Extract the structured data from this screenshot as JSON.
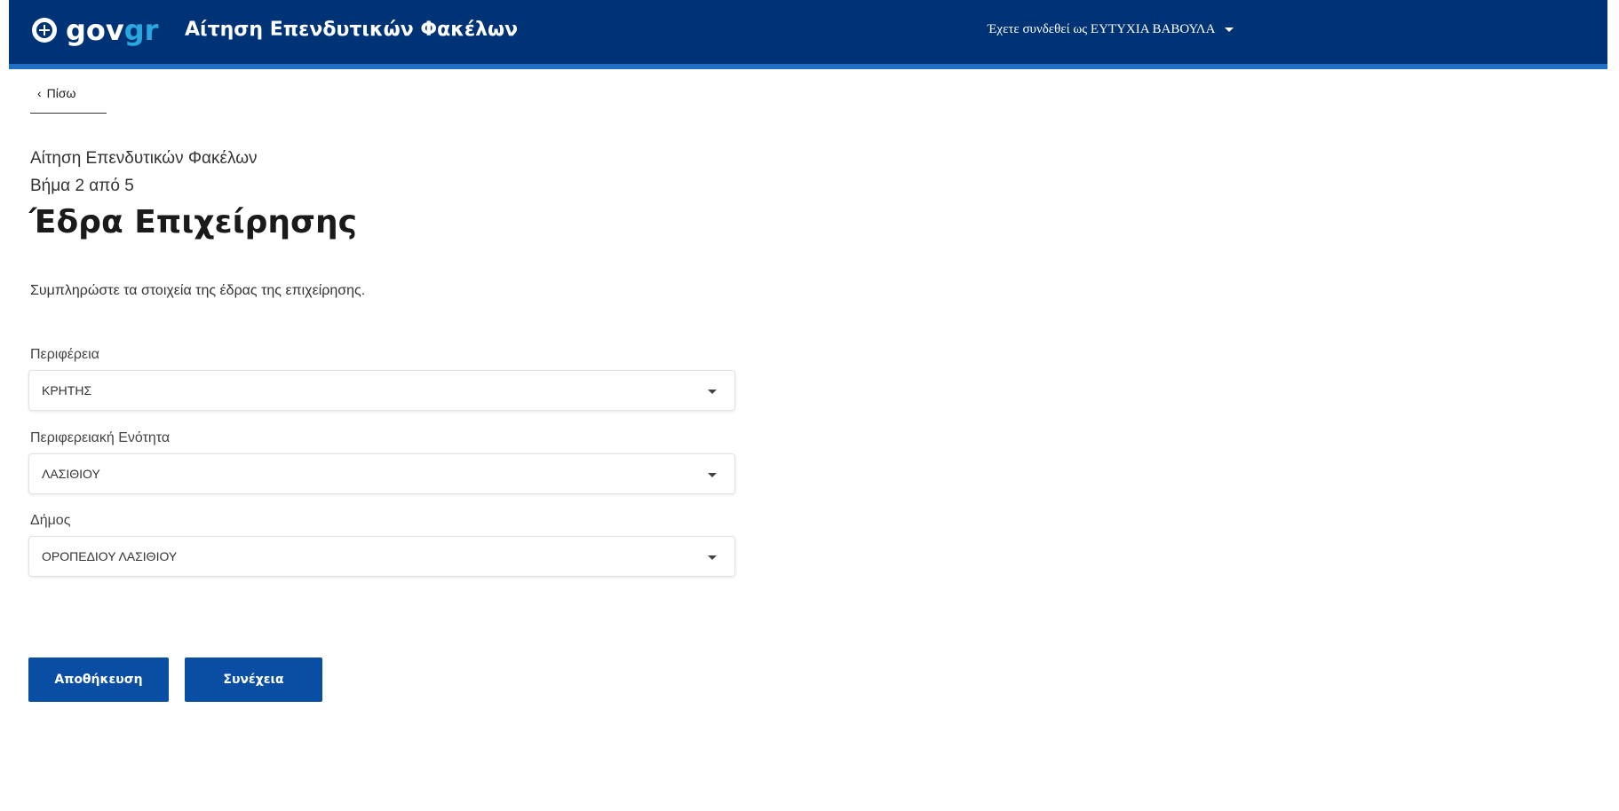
{
  "header": {
    "logo_text_gov": "gov",
    "logo_text_gr": "gr",
    "app_title": "Αίτηση Επενδυτικών Φακέλων",
    "user_text": "Έχετε συνδεθεί ως ΕΥΤΥΧΙΑ ΒΑΒΟΥΛΑ",
    "colors": {
      "background": "#003376",
      "accent_stripe": "#1f6fc2",
      "logo_gr": "#29a8e0"
    }
  },
  "back": {
    "label": "Πίσω"
  },
  "form_header": {
    "caption": "Αίτηση Επενδυτικών Φακέλων",
    "step": "Βήμα 2 από 5",
    "title": "Έδρα Επιχείρησης",
    "hint": "Συμπληρώστε τα στοιχεία της έδρας της επιχείρησης."
  },
  "fields": [
    {
      "label": "Περιφέρεια",
      "value": "ΚΡΗΤΗΣ"
    },
    {
      "label": "Περιφερειακή Ενότητα",
      "value": "ΛΑΣΙΘΙΟΥ"
    },
    {
      "label": "Δήμος",
      "value": "ΟΡΟΠΕΔΙΟΥ ΛΑΣΙΘΙΟΥ"
    }
  ],
  "actions": {
    "save_label": "Αποθήκευση",
    "continue_label": "Συνέχεια",
    "button_color": "#0a4ea3"
  }
}
